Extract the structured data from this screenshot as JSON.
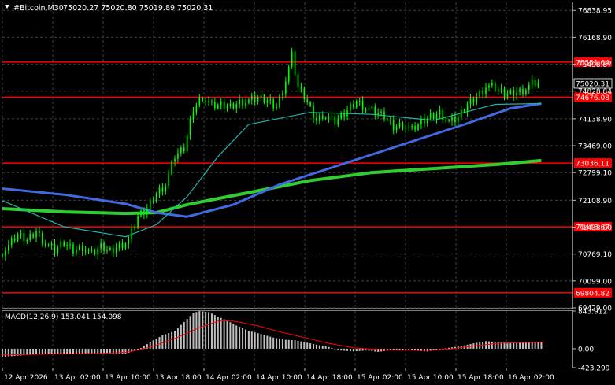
{
  "header": {
    "symbol": "#Bitcoin,M30",
    "ohlc": "75020.27 75020.80 75019.89 75020.31"
  },
  "price_axis": {
    "ticks": [
      "76838.95",
      "76168.90",
      "75498.87",
      "74828.84",
      "74138.90",
      "73469.00",
      "72799.10",
      "72108.90",
      "71438.90",
      "70769.10",
      "70099.00",
      "69429.00"
    ],
    "range": [
      69429.0,
      77040.0
    ]
  },
  "current_price": {
    "label": "75020.31",
    "value": 75020.31,
    "color": "#ffffff"
  },
  "horizontal_levels": [
    {
      "label": "75551.64",
      "value": 75551.64
    },
    {
      "label": "74676.08",
      "value": 74676.08
    },
    {
      "label": "73036.11",
      "value": 73036.11
    },
    {
      "label": "71446.67",
      "value": 71446.67
    },
    {
      "label": "69804.82",
      "value": 69804.82
    }
  ],
  "time_axis": {
    "labels": [
      "12 Apr 2026",
      "13 Apr 02:00",
      "13 Apr 10:00",
      "13 Apr 18:00",
      "14 Apr 02:00",
      "14 Apr 10:00",
      "14 Apr 18:00",
      "15 Apr 02:00",
      "15 Apr 10:00",
      "15 Apr 18:00",
      "16 Apr 02:00"
    ]
  },
  "macd": {
    "label": "MACD(12,26,9) 153.041 154.098",
    "ticks": [
      "843.912",
      "0.00",
      "-423.299"
    ],
    "range": [
      -423.299,
      843.912
    ]
  },
  "colors": {
    "background": "#000000",
    "grid": "#404040",
    "bull_candle": "#00ff00",
    "bear_candle": "#00ff00",
    "level_line": "#ff0000",
    "ma_fast": "#20b2aa",
    "ma_mid": "#4169e1",
    "ma_slow": "#32cd32",
    "macd_hist": "#c0c0c0",
    "macd_signal": "#ff0000"
  },
  "chart_data": {
    "type": "candlestick",
    "timeframe": "M30",
    "close_series_sample": [
      [
        0,
        70760
      ],
      [
        6,
        70960
      ],
      [
        12,
        71250
      ],
      [
        18,
        71120
      ],
      [
        24,
        71350
      ],
      [
        30,
        71020
      ],
      [
        36,
        70850
      ],
      [
        42,
        71050
      ],
      [
        48,
        70880
      ],
      [
        54,
        70950
      ],
      [
        60,
        70760
      ],
      [
        66,
        70950
      ],
      [
        72,
        70850
      ],
      [
        78,
        70980
      ],
      [
        84,
        71100
      ],
      [
        90,
        71700
      ],
      [
        96,
        71900
      ],
      [
        102,
        72300
      ],
      [
        108,
        72500
      ],
      [
        114,
        73200
      ],
      [
        120,
        73400
      ],
      [
        126,
        74400
      ],
      [
        132,
        74700
      ],
      [
        138,
        74450
      ],
      [
        144,
        74480
      ],
      [
        150,
        74450
      ],
      [
        156,
        74560
      ],
      [
        162,
        74580
      ],
      [
        168,
        74650
      ],
      [
        174,
        74600
      ],
      [
        180,
        74450
      ],
      [
        186,
        75100
      ],
      [
        190,
        75700
      ],
      [
        194,
        74900
      ],
      [
        198,
        74700
      ],
      [
        202,
        74400
      ],
      [
        206,
        74100
      ],
      [
        210,
        74250
      ],
      [
        214,
        74150
      ],
      [
        218,
        74050
      ],
      [
        222,
        74200
      ],
      [
        226,
        74350
      ],
      [
        232,
        74600
      ],
      [
        238,
        74400
      ],
      [
        244,
        74300
      ],
      [
        250,
        74200
      ],
      [
        256,
        73950
      ],
      [
        262,
        74000
      ],
      [
        268,
        73850
      ],
      [
        274,
        74050
      ],
      [
        280,
        74200
      ],
      [
        286,
        74300
      ],
      [
        292,
        74050
      ],
      [
        298,
        74150
      ],
      [
        304,
        74500
      ],
      [
        310,
        74700
      ],
      [
        316,
        74950
      ],
      [
        322,
        74900
      ],
      [
        328,
        74750
      ],
      [
        334,
        74800
      ],
      [
        340,
        74850
      ],
      [
        346,
        75000
      ],
      [
        350,
        75020
      ]
    ],
    "ma_fast": [
      [
        0,
        72100
      ],
      [
        40,
        71450
      ],
      [
        80,
        71200
      ],
      [
        100,
        71500
      ],
      [
        120,
        72200
      ],
      [
        140,
        73200
      ],
      [
        160,
        74000
      ],
      [
        200,
        74300
      ],
      [
        240,
        74250
      ],
      [
        280,
        74100
      ],
      [
        300,
        74300
      ],
      [
        320,
        74500
      ],
      [
        350,
        74520
      ]
    ],
    "ma_mid": [
      [
        0,
        72400
      ],
      [
        40,
        72250
      ],
      [
        80,
        72020
      ],
      [
        100,
        71800
      ],
      [
        120,
        71700
      ],
      [
        150,
        72000
      ],
      [
        180,
        72500
      ],
      [
        220,
        73000
      ],
      [
        260,
        73500
      ],
      [
        300,
        74000
      ],
      [
        330,
        74400
      ],
      [
        350,
        74520
      ]
    ],
    "ma_slow": [
      [
        0,
        71900
      ],
      [
        40,
        71820
      ],
      [
        80,
        71780
      ],
      [
        100,
        71800
      ],
      [
        120,
        72000
      ],
      [
        160,
        72300
      ],
      [
        200,
        72600
      ],
      [
        240,
        72800
      ],
      [
        280,
        72900
      ],
      [
        320,
        73000
      ],
      [
        350,
        73100
      ]
    ],
    "macd_histogram": [
      [
        0,
        -180
      ],
      [
        20,
        -130
      ],
      [
        40,
        -110
      ],
      [
        60,
        -100
      ],
      [
        70,
        -120
      ],
      [
        80,
        -110
      ],
      [
        88,
        -30
      ],
      [
        96,
        150
      ],
      [
        104,
        300
      ],
      [
        112,
        400
      ],
      [
        118,
        600
      ],
      [
        124,
        800
      ],
      [
        128,
        843
      ],
      [
        134,
        820
      ],
      [
        140,
        720
      ],
      [
        146,
        630
      ],
      [
        152,
        520
      ],
      [
        160,
        400
      ],
      [
        168,
        330
      ],
      [
        176,
        250
      ],
      [
        184,
        200
      ],
      [
        190,
        190
      ],
      [
        196,
        150
      ],
      [
        204,
        90
      ],
      [
        212,
        40
      ],
      [
        220,
        -40
      ],
      [
        228,
        -60
      ],
      [
        236,
        -40
      ],
      [
        244,
        -70
      ],
      [
        252,
        -30
      ],
      [
        260,
        -20
      ],
      [
        268,
        -40
      ],
      [
        276,
        -60
      ],
      [
        282,
        -20
      ],
      [
        290,
        20
      ],
      [
        298,
        60
      ],
      [
        306,
        120
      ],
      [
        314,
        170
      ],
      [
        322,
        150
      ],
      [
        330,
        130
      ],
      [
        338,
        140
      ],
      [
        346,
        150
      ],
      [
        352,
        150
      ]
    ],
    "macd_signal": [
      [
        0,
        -140
      ],
      [
        30,
        -120
      ],
      [
        60,
        -110
      ],
      [
        80,
        -80
      ],
      [
        96,
        30
      ],
      [
        112,
        230
      ],
      [
        128,
        470
      ],
      [
        140,
        620
      ],
      [
        150,
        620
      ],
      [
        165,
        520
      ],
      [
        180,
        380
      ],
      [
        196,
        250
      ],
      [
        212,
        120
      ],
      [
        228,
        20
      ],
      [
        244,
        -20
      ],
      [
        260,
        -30
      ],
      [
        276,
        -30
      ],
      [
        290,
        -10
      ],
      [
        306,
        60
      ],
      [
        322,
        120
      ],
      [
        340,
        140
      ],
      [
        352,
        150
      ]
    ]
  }
}
